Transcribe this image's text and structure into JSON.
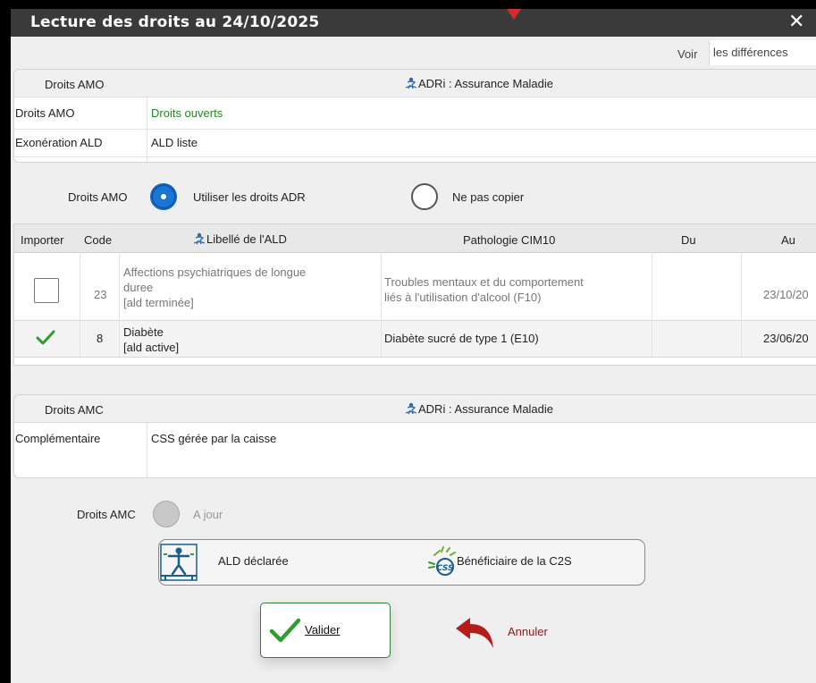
{
  "window": {
    "title": "Lecture des droits au 24/10/2025",
    "close_glyph": "✕"
  },
  "voir": {
    "label": "Voir",
    "value": "les différences"
  },
  "amo_panel": {
    "header_left": "Droits AMO",
    "header_source": "ADRi : Assurance Maladie",
    "rows": [
      {
        "label": "Droits AMO",
        "value": "Droits ouverts"
      },
      {
        "label": "Exonération ALD",
        "value": "ALD liste"
      }
    ]
  },
  "amo_choice": {
    "label": "Droits AMO",
    "option_use": "Utiliser les droits ADR",
    "option_skip": "Ne pas copier",
    "selected": "option_use"
  },
  "ald_table": {
    "columns": {
      "importer": "Importer",
      "code": "Code",
      "libelle": "Libellé de l'ALD",
      "pathologie": "Pathologie CIM10",
      "du": "Du",
      "au": "Au"
    },
    "rows": [
      {
        "imported": false,
        "code": "23",
        "libelle_line1": "Affections psychiatriques de longue",
        "libelle_line2": "duree",
        "status": "[ald terminée]",
        "pathologie_line1": "Troubles mentaux et du comportement",
        "pathologie_line2": "liés à l'utilisation d'alcool (F10)",
        "du": "",
        "au": "23/10/20"
      },
      {
        "imported": true,
        "code": "8",
        "libelle_line1": "Diabète",
        "libelle_line2": "",
        "status": "[ald active]",
        "pathologie_line1": "Diabète sucré de type 1 (E10)",
        "pathologie_line2": "",
        "du": "",
        "au": "23/06/20"
      }
    ]
  },
  "amc_panel": {
    "header_left": "Droits AMC",
    "header_source": "ADRi : Assurance Maladie",
    "rows": [
      {
        "label": "Complémentaire",
        "value": "CSS gérée par la caisse"
      }
    ]
  },
  "amc_choice": {
    "label": "Droits AMC",
    "option": "A jour"
  },
  "status_buttons": {
    "ald": "ALD déclarée",
    "c2s": "Bénéficiaire de la C2S",
    "css_icon_text": "CSS"
  },
  "actions": {
    "validate": "Valider",
    "cancel": "Annuler"
  },
  "colors": {
    "title_bar": "#3a3a3a",
    "accent_blue": "#1976d2",
    "ok_green": "#1f8a1f",
    "cancel_red": "#b71c1c"
  }
}
